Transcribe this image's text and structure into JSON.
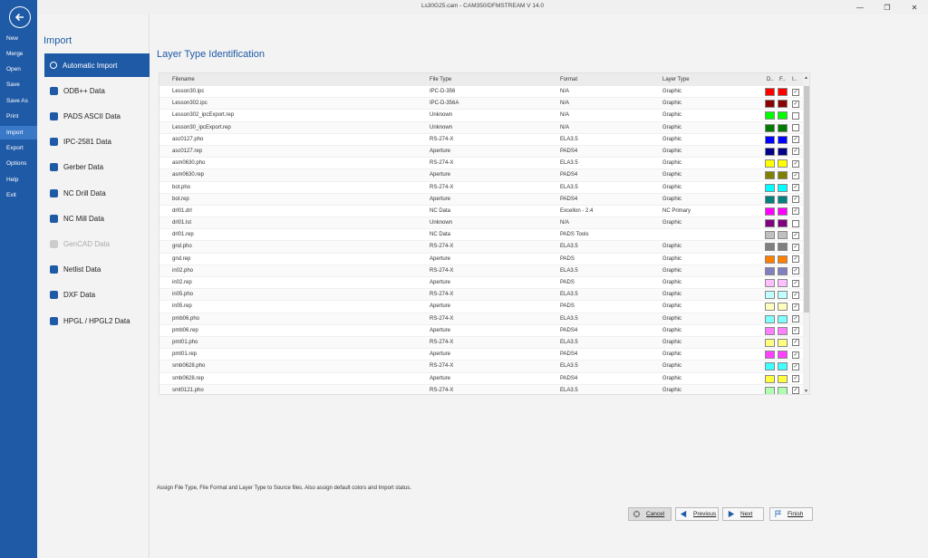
{
  "window": {
    "title": "Ls30G25.cam - CAM350/DFMSTREAM V 14.0"
  },
  "nav": {
    "items": [
      "New",
      "Merge",
      "Open",
      "Save",
      "Save As",
      "Print",
      "Import",
      "Export",
      "Options",
      "Help",
      "Exit"
    ],
    "active_index": 6
  },
  "import_panel": {
    "title": "Import",
    "items": [
      "Automatic Import",
      "ODB++ Data",
      "PADS ASCII Data",
      "IPC-2581 Data",
      "Gerber Data",
      "NC Drill Data",
      "NC Mill Data",
      "GenCAD Data",
      "Netlist Data",
      "DXF Data",
      "HPGL / HPGL2 Data"
    ],
    "active_index": 0,
    "disabled_index": 7
  },
  "main": {
    "title": "Layer Type Identification",
    "columns": {
      "filename": "Filename",
      "filetype": "File Type",
      "format": "Format",
      "layertype": "Layer Type",
      "d": "D..",
      "f": "F..",
      "i": "I.."
    },
    "rows": [
      {
        "filename": "Lesson30.ipc",
        "filetype": "IPC-D-356",
        "format": "N/A",
        "layertype": "Graphic",
        "color": "#ff0000",
        "color2": "#ff0000",
        "checked": true
      },
      {
        "filename": "Lesson302.ipc",
        "filetype": "IPC-D-356A",
        "format": "N/A",
        "layertype": "Graphic",
        "color": "#8b0000",
        "color2": "#8b0000",
        "checked": true
      },
      {
        "filename": "Lesson302_ipcExport.rep",
        "filetype": "Unknown",
        "format": "N/A",
        "layertype": "Graphic",
        "color": "#00ff00",
        "color2": "#00ff00",
        "checked": false
      },
      {
        "filename": "Lesson30_ipcExport.rep",
        "filetype": "Unknown",
        "format": "N/A",
        "layertype": "Graphic",
        "color": "#007a00",
        "color2": "#007a00",
        "checked": false
      },
      {
        "filename": "asc0127.pho",
        "filetype": "RS-274-X",
        "format": "ELA3.5",
        "layertype": "Graphic",
        "color": "#0000ff",
        "color2": "#0000ff",
        "checked": true
      },
      {
        "filename": "asc0127.rep",
        "filetype": "Aperture",
        "format": "PADS4",
        "layertype": "Graphic",
        "color": "#00008b",
        "color2": "#00008b",
        "checked": true
      },
      {
        "filename": "asm0630.pho",
        "filetype": "RS-274-X",
        "format": "ELA3.5",
        "layertype": "Graphic",
        "color": "#ffff00",
        "color2": "#ffff00",
        "checked": true
      },
      {
        "filename": "asm0630.rep",
        "filetype": "Aperture",
        "format": "PADS4",
        "layertype": "Graphic",
        "color": "#808000",
        "color2": "#808000",
        "checked": true
      },
      {
        "filename": "bot.pho",
        "filetype": "RS-274-X",
        "format": "ELA3.5",
        "layertype": "Graphic",
        "color": "#00ffff",
        "color2": "#00ffff",
        "checked": true
      },
      {
        "filename": "bot.rep",
        "filetype": "Aperture",
        "format": "PADS4",
        "layertype": "Graphic",
        "color": "#008080",
        "color2": "#008080",
        "checked": true
      },
      {
        "filename": "drl01.drl",
        "filetype": "NC Data",
        "format": "Excellon - 2.4",
        "layertype": "NC Primary",
        "color": "#ff00ff",
        "color2": "#ff00ff",
        "checked": true
      },
      {
        "filename": "drl01.lst",
        "filetype": "Unknown",
        "format": "N/A",
        "layertype": "Graphic",
        "color": "#800080",
        "color2": "#800080",
        "checked": false
      },
      {
        "filename": "drl01.rep",
        "filetype": "NC Data",
        "format": "PADS Tools",
        "layertype": "",
        "color": "#c0c0c0",
        "color2": "#c0c0c0",
        "checked": true
      },
      {
        "filename": "gnd.pho",
        "filetype": "RS-274-X",
        "format": "ELA3.5",
        "layertype": "Graphic",
        "color": "#808080",
        "color2": "#808080",
        "checked": true
      },
      {
        "filename": "gnd.rep",
        "filetype": "Aperture",
        "format": "PADS",
        "layertype": "Graphic",
        "color": "#ff8000",
        "color2": "#ff8000",
        "checked": true
      },
      {
        "filename": "in02.pho",
        "filetype": "RS-274-X",
        "format": "ELA3.5",
        "layertype": "Graphic",
        "color": "#8080c0",
        "color2": "#8080c0",
        "checked": true
      },
      {
        "filename": "in02.rep",
        "filetype": "Aperture",
        "format": "PADS",
        "layertype": "Graphic",
        "color": "#ffc0ff",
        "color2": "#ffc0ff",
        "checked": true
      },
      {
        "filename": "in05.pho",
        "filetype": "RS-274-X",
        "format": "ELA3.5",
        "layertype": "Graphic",
        "color": "#c0ffff",
        "color2": "#c0ffff",
        "checked": true
      },
      {
        "filename": "in05.rep",
        "filetype": "Aperture",
        "format": "PADS",
        "layertype": "Graphic",
        "color": "#ffffc0",
        "color2": "#ffffc0",
        "checked": true
      },
      {
        "filename": "pmb06.pho",
        "filetype": "RS-274-X",
        "format": "ELA3.5",
        "layertype": "Graphic",
        "color": "#80ffff",
        "color2": "#80ffff",
        "checked": true
      },
      {
        "filename": "pmb06.rep",
        "filetype": "Aperture",
        "format": "PADS4",
        "layertype": "Graphic",
        "color": "#ff80ff",
        "color2": "#ff80ff",
        "checked": true
      },
      {
        "filename": "pmt01.pho",
        "filetype": "RS-274-X",
        "format": "ELA3.5",
        "layertype": "Graphic",
        "color": "#ffff80",
        "color2": "#ffff80",
        "checked": true
      },
      {
        "filename": "pmt01.rep",
        "filetype": "Aperture",
        "format": "PADS4",
        "layertype": "Graphic",
        "color": "#ff40ff",
        "color2": "#ff40ff",
        "checked": true
      },
      {
        "filename": "smb0628.pho",
        "filetype": "RS-274-X",
        "format": "ELA3.5",
        "layertype": "Graphic",
        "color": "#40ffff",
        "color2": "#40ffff",
        "checked": true
      },
      {
        "filename": "smb0628.rep",
        "filetype": "Aperture",
        "format": "PADS4",
        "layertype": "Graphic",
        "color": "#ffff40",
        "color2": "#ffff40",
        "checked": true
      },
      {
        "filename": "smt0121.pho",
        "filetype": "RS-274-X",
        "format": "ELA3.5",
        "layertype": "Graphic",
        "color": "#b0ffb0",
        "color2": "#b0ffb0",
        "checked": true
      }
    ],
    "hint": "Assign File Type, File Format and Layer Type to Source files. Also assign default colors and Import status."
  },
  "buttons": {
    "cancel": "Cancel",
    "previous": "Previous",
    "next": "Next",
    "finish": "Finish"
  },
  "colors": {
    "accent": "#1f5aa6"
  }
}
